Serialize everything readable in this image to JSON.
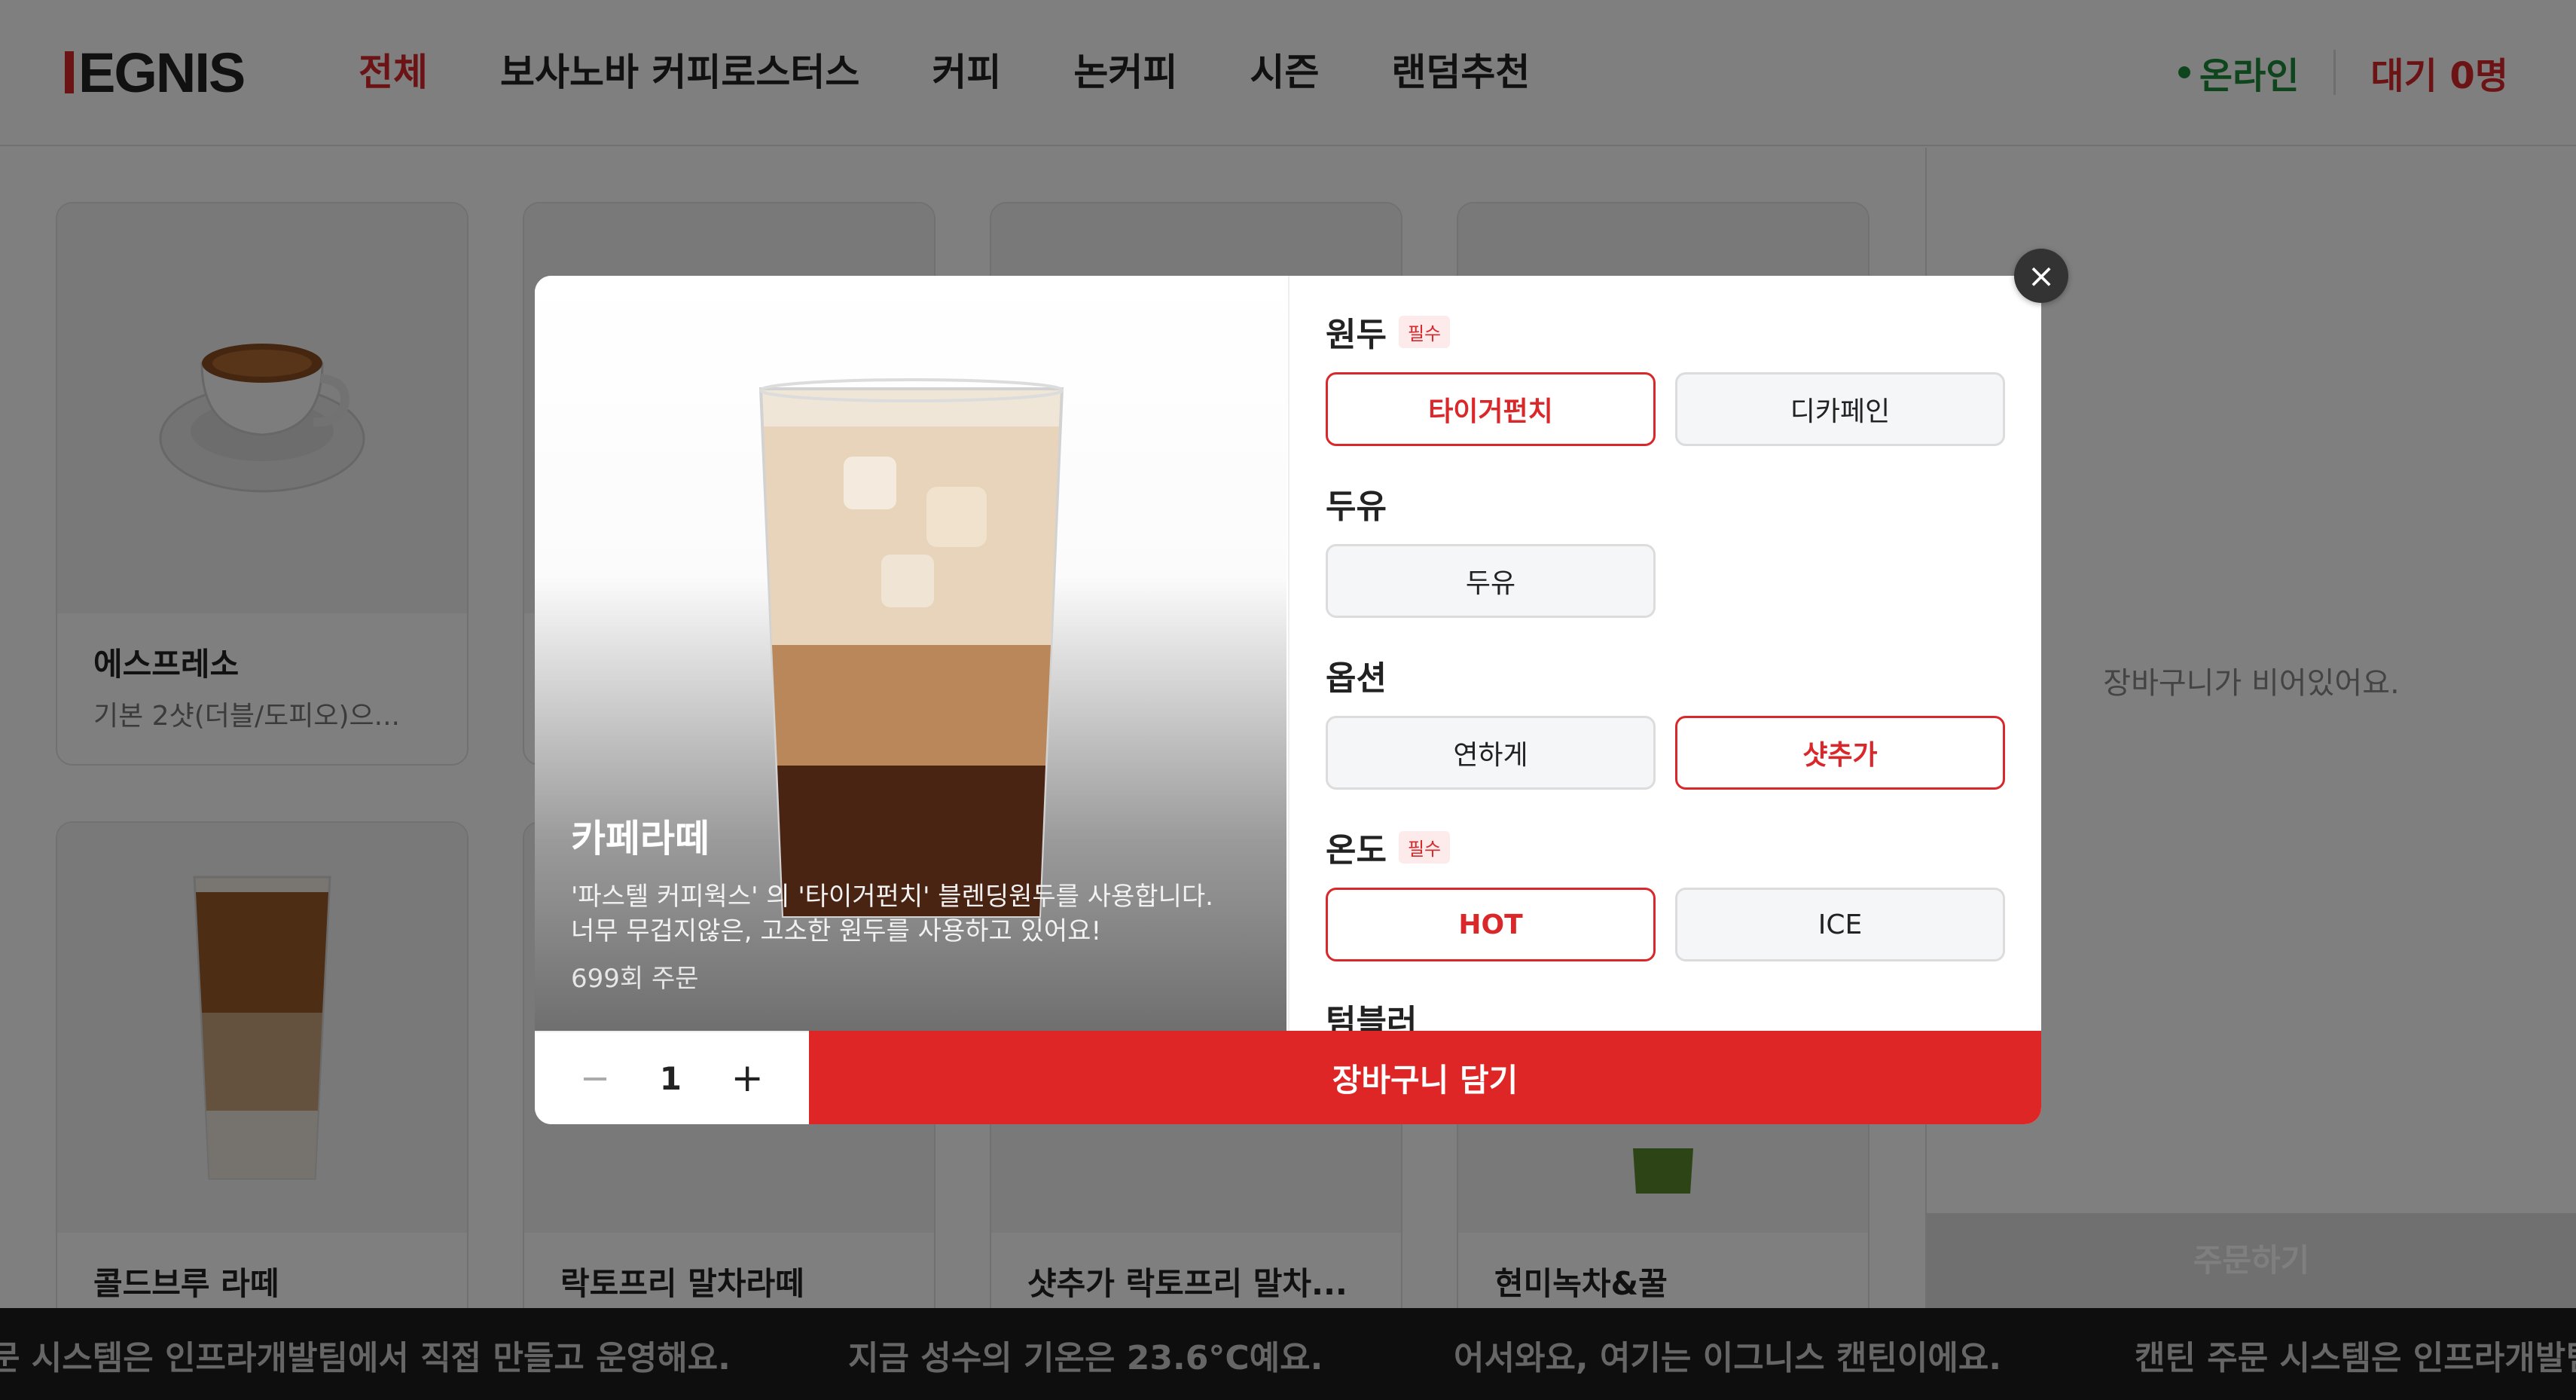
{
  "brand": {
    "logo_text": "EGNIS",
    "accent": "#d9272a"
  },
  "nav": {
    "items": [
      "전체",
      "보사노바 커피로스터스",
      "커피",
      "논커피",
      "시즌",
      "랜덤추천"
    ],
    "active": "전체"
  },
  "status": {
    "online": "온라인",
    "wait": "대기 0명",
    "online_color": "#1f8a3b"
  },
  "products": [
    {
      "name": "에스프레소",
      "desc": "기본 2샷(더블/도피오)으..."
    },
    {
      "name": "",
      "desc": ""
    },
    {
      "name": "",
      "desc": ""
    },
    {
      "name": "",
      "desc": ""
    },
    {
      "name": "콜드브루 라떼",
      "desc": ""
    },
    {
      "name": "락토프리 말차라떼",
      "desc": ""
    },
    {
      "name": "샷추가 락토프리 말차...",
      "desc": ""
    },
    {
      "name": "현미녹차&꿀",
      "desc": ""
    }
  ],
  "cart": {
    "empty": "장바구니가 비어있어요.",
    "order_button": "주문하기"
  },
  "ticker": [
    "문 시스템은 인프라개발팀에서 직접 만들고 운영해요.",
    "지금 성수의 기온은 23.6°C예요.",
    "어서와요, 여기는 이그니스 캔틴이에요.",
    "캔틴 주문 시스템은 인프라개발팀"
  ],
  "modal": {
    "title": "카페라떼",
    "desc_line1": "'파스텔 커피웍스' 의 '타이거펀치' 블렌딩원두를 사용합니다.",
    "desc_line2": "너무 무겁지않은, 고소한 원두를 사용하고 있어요!",
    "order_count": "699회 주문",
    "required_badge": "필수",
    "groups": [
      {
        "title": "원두",
        "required": true,
        "options": [
          "타이거펀치",
          "디카페인"
        ],
        "selected": "타이거펀치"
      },
      {
        "title": "두유",
        "required": false,
        "options": [
          "두유"
        ],
        "selected": ""
      },
      {
        "title": "옵션",
        "required": false,
        "options": [
          "연하게",
          "샷추가"
        ],
        "selected": "샷추가"
      },
      {
        "title": "온도",
        "required": true,
        "options": [
          "HOT",
          "ICE"
        ],
        "selected": "HOT"
      },
      {
        "title": "텀블러",
        "required": false,
        "options": [],
        "selected": ""
      }
    ],
    "quantity": "1",
    "minus": "−",
    "plus": "+",
    "add_to_cart": "장바구니 담기",
    "close": "×"
  }
}
